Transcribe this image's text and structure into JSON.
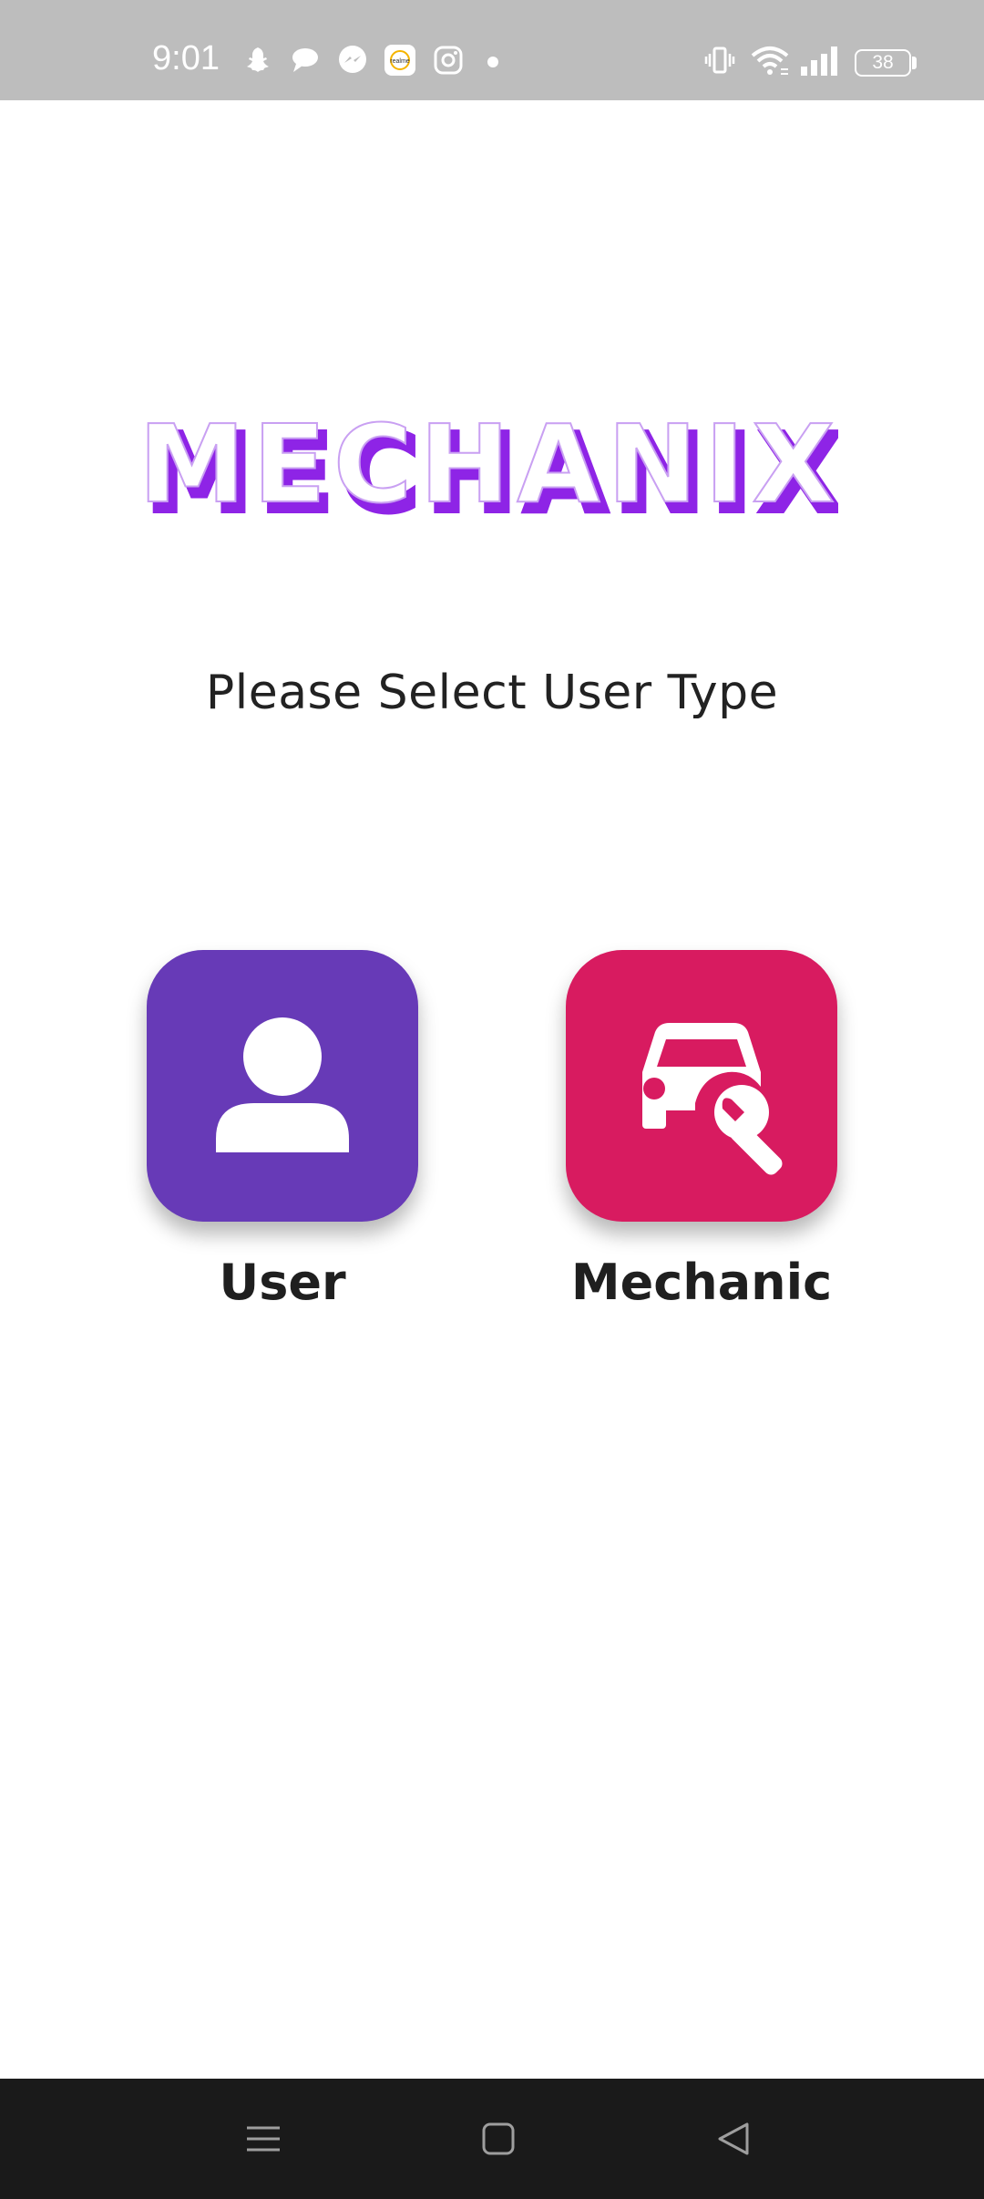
{
  "status_bar": {
    "time": "9:01",
    "battery_level": "38",
    "icons": [
      "snapchat-icon",
      "chat-bubble-icon",
      "messenger-icon",
      "realme-icon",
      "instagram-icon",
      "notification-dot-icon",
      "vibrate-icon",
      "wifi-icon",
      "signal-icon",
      "battery-icon"
    ]
  },
  "app": {
    "logo_text": "MECHANIX",
    "logo_color": "#ffffff",
    "logo_shadow_color": "#8e24e6"
  },
  "prompt": {
    "text": "Please Select User Type"
  },
  "options": [
    {
      "label": "User",
      "icon": "person-icon",
      "color": "#673ab7"
    },
    {
      "label": "Mechanic",
      "icon": "car-wrench-icon",
      "color": "#d81b60"
    }
  ],
  "nav_bar": {
    "buttons": [
      "menu-icon",
      "home-icon",
      "back-icon"
    ]
  }
}
